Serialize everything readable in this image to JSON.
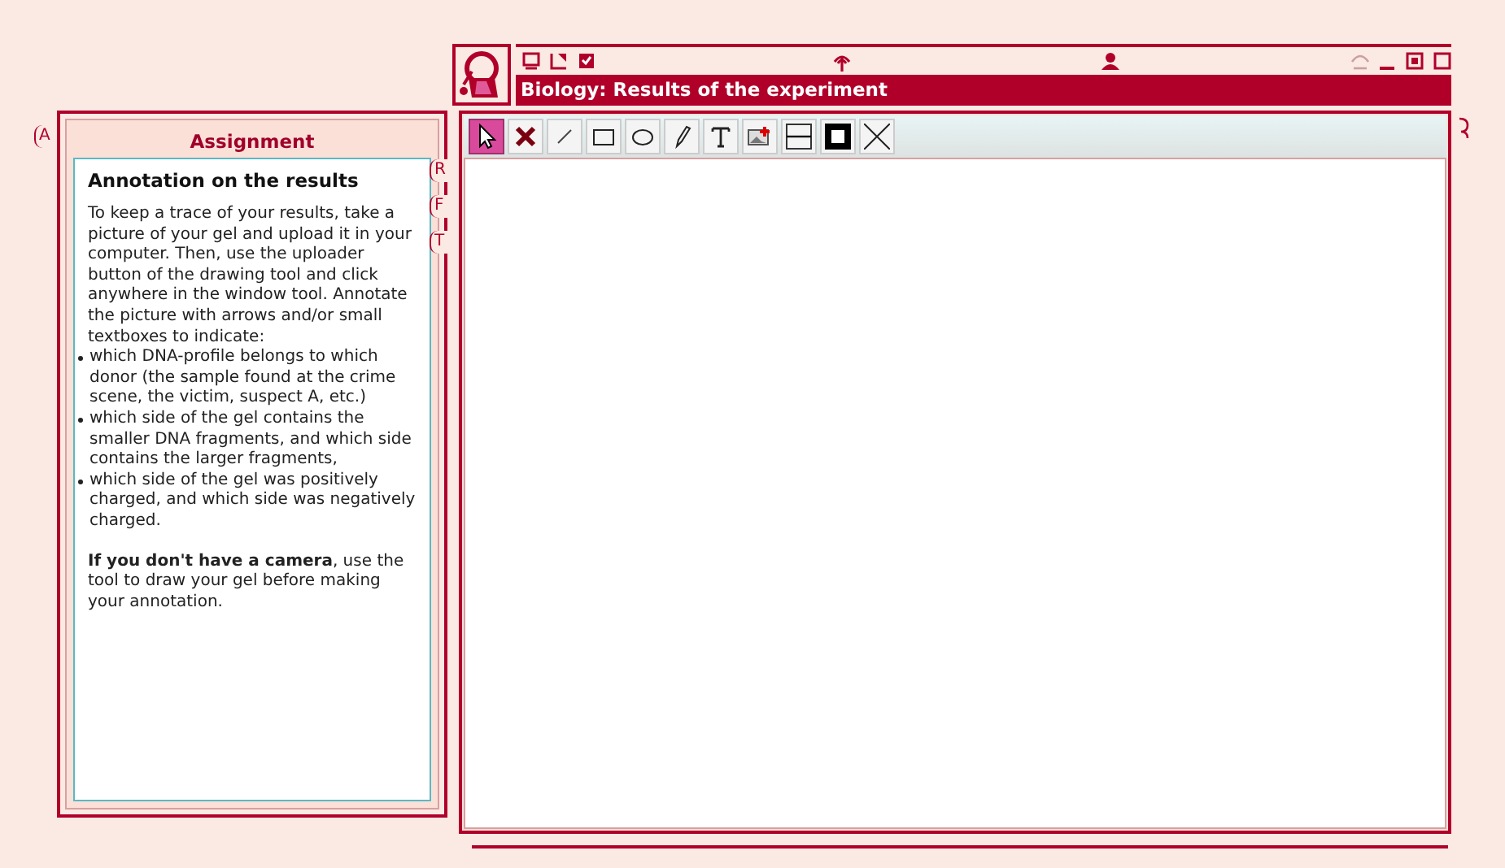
{
  "window": {
    "title": "Biology: Results of the experiment"
  },
  "side_tabs": {
    "left": "A",
    "right": [
      "R",
      "F",
      "T"
    ]
  },
  "assignment": {
    "heading": "Assignment",
    "title": "Annotation on the results",
    "intro": "To keep a trace of your results, take a picture of your gel and upload it in your computer. Then, use the uploader button of the drawing tool and click anywhere in the window tool. Annotate the picture with arrows and/or small textboxes to indicate:",
    "bullets": [
      "which DNA-profile belongs to which donor (the sample found at the crime scene, the victim, suspect A, etc.)",
      "which side of the gel contains the smaller DNA fragments, and which side contains the larger fragments,",
      "which side of the gel was positively charged, and which side was negatively charged."
    ],
    "note": "**If you don't have a camera**, use the tool to draw your gel before making your annotation."
  },
  "tools": [
    {
      "kind": "select",
      "selected": true
    },
    {
      "kind": "delete",
      "selected": false
    },
    {
      "kind": "line",
      "selected": false
    },
    {
      "kind": "rectangle",
      "selected": false
    },
    {
      "kind": "ellipse",
      "selected": false
    },
    {
      "kind": "pencil",
      "selected": false
    },
    {
      "kind": "text",
      "selected": false
    },
    {
      "kind": "image",
      "selected": false
    },
    {
      "kind": "stroke",
      "selected": false
    },
    {
      "kind": "fill",
      "selected": false
    },
    {
      "kind": "nofill",
      "selected": false
    }
  ]
}
